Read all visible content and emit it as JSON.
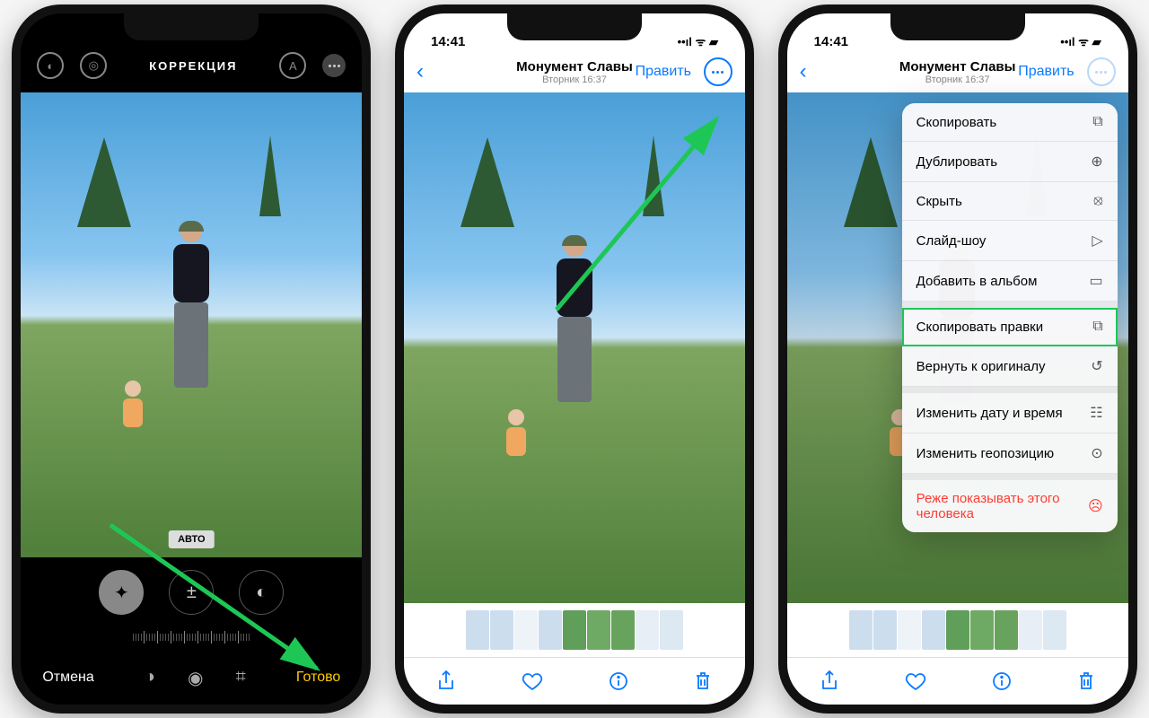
{
  "phone1": {
    "title": "КОРРЕКЦИЯ",
    "auto_label": "АВТО",
    "cancel": "Отмена",
    "done": "Готово"
  },
  "phone2": {
    "time": "14:41",
    "location": "Монумент Славы",
    "subtitle": "Вторник 16:37",
    "edit": "Править"
  },
  "phone3": {
    "time": "14:41",
    "location": "Монумент Славы",
    "subtitle": "Вторник 16:37",
    "edit": "Править",
    "menu": {
      "copy": "Скопировать",
      "duplicate": "Дублировать",
      "hide": "Скрыть",
      "slideshow": "Слайд-шоу",
      "add_album": "Добавить в альбом",
      "copy_edits": "Скопировать правки",
      "revert": "Вернуть к оригиналу",
      "change_date": "Изменить дату и время",
      "change_location": "Изменить геопозицию",
      "suggest_less": "Реже показывать этого человека"
    }
  }
}
